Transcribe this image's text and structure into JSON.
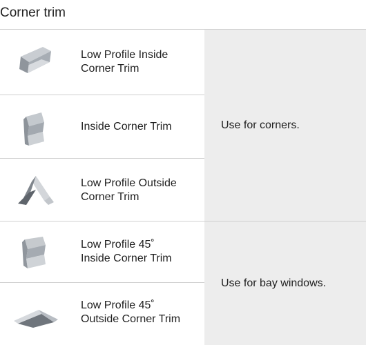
{
  "section": {
    "title": "Corner trim"
  },
  "products": [
    {
      "name_line1": "Low Profile Inside",
      "name_line2": "Corner Trim",
      "icon": "low-profile-inside-corner-trim-image"
    },
    {
      "name_line1": "Inside Corner Trim",
      "name_line2": "",
      "icon": "inside-corner-trim-image"
    },
    {
      "name_line1": "Low Profile Outside",
      "name_line2": "Corner Trim",
      "icon": "low-profile-outside-corner-trim-image"
    },
    {
      "name_line1": "Low Profile 45˚",
      "name_line2": "Inside Corner Trim",
      "icon": "low-profile-45-inside-corner-trim-image"
    },
    {
      "name_line1": "Low Profile 45˚",
      "name_line2": "Outside Corner Trim",
      "icon": "low-profile-45-outside-corner-trim-image"
    }
  ],
  "uses": [
    {
      "text": "Use for corners."
    },
    {
      "text": "Use for bay windows."
    }
  ],
  "colors": {
    "use_cell_bg": "#ededed",
    "divider": "#cfcfcf",
    "trim_metal": "#b9bec4"
  }
}
